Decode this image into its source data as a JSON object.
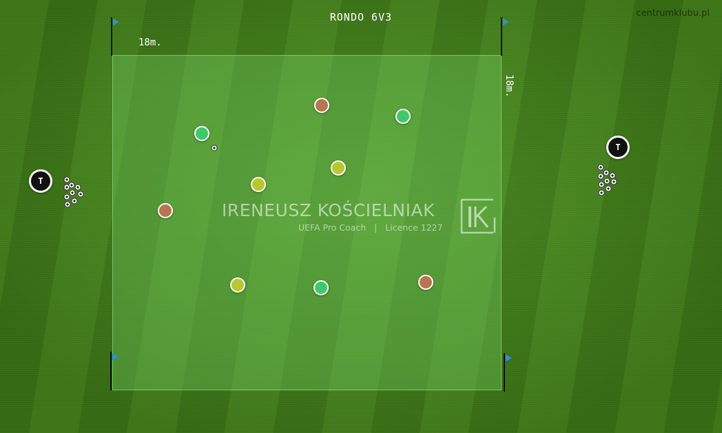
{
  "header": {
    "title": "RONDO 6V3",
    "site": "centrumklubu.pl"
  },
  "field": {
    "width_label": "18m.",
    "height_label": "18m."
  },
  "coach": {
    "label": "T"
  },
  "watermark": {
    "name": "IRENEUSZ KOŚCIELNIAK",
    "subtitle": "UEFA Pro Coach   |   Licence 1227",
    "logo": "IK"
  },
  "colors": {
    "team_green": "#3fc96c",
    "team_yellow": "#b9c72e",
    "team_brown": "#b8764e",
    "flag": "#2e8fe6",
    "pitch": "#4a8f1c"
  },
  "icons": {
    "flag": "corner-flag-icon",
    "ball": "ball-icon",
    "coach": "coach-marker-icon"
  }
}
